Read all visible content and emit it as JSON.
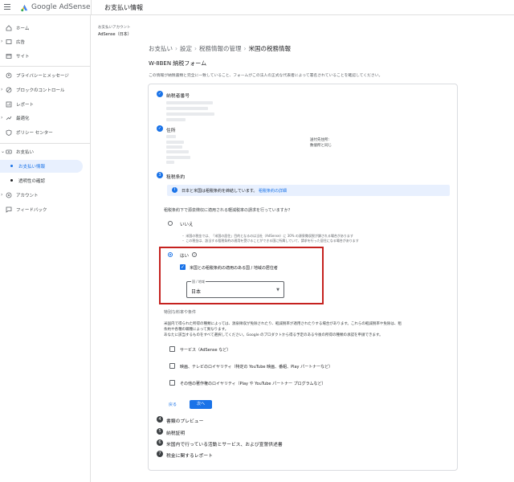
{
  "app": {
    "brand": "Google AdSense",
    "page_heading": "お支払い情報"
  },
  "sidebar": {
    "items": [
      {
        "label": "ホーム",
        "icon": "home-icon"
      },
      {
        "label": "広告",
        "icon": "ads-icon"
      },
      {
        "label": "サイト",
        "icon": "sites-icon"
      },
      {
        "label": "プライバシーとメッセージ",
        "icon": "privacy-icon"
      },
      {
        "label": "ブロックのコントロール",
        "icon": "block-icon"
      },
      {
        "label": "レポート",
        "icon": "report-icon"
      },
      {
        "label": "最適化",
        "icon": "optimize-icon"
      },
      {
        "label": "ポリシー センター",
        "icon": "policy-icon"
      },
      {
        "label": "お支払い",
        "icon": "payments-icon"
      },
      {
        "label": "お支払い情報",
        "icon": "dot-icon"
      },
      {
        "label": "透明性の確認",
        "icon": "dot-icon"
      },
      {
        "label": "アカウント",
        "icon": "account-icon"
      },
      {
        "label": "フィードバック",
        "icon": "feedback-icon"
      }
    ]
  },
  "account": {
    "label": "お支払いアカウント",
    "name": "AdSense（日本）"
  },
  "breadcrumb": [
    "お支払い",
    "設定",
    "税務情報の管理",
    "米国の税務情報"
  ],
  "form": {
    "title": "W-8BEN 納税フォーム",
    "description": "この情報が納税書類と完全に一致していること、フォームがこの法人の正式な代表者によって署名されていることを確認してください。"
  },
  "steps": [
    {
      "label": "納税者番号",
      "state": "done"
    },
    {
      "label": "住所",
      "state": "done"
    },
    {
      "label": "租税条約",
      "state": "current",
      "number": "3"
    },
    {
      "label": "書類のプレビュー",
      "state": "todo",
      "number": "4"
    },
    {
      "label": "納税証明",
      "state": "todo",
      "number": "5"
    },
    {
      "label": "米国内で行っている活動とサービス、および宣誓供述書",
      "state": "todo",
      "number": "6"
    },
    {
      "label": "税金に関するレポート",
      "state": "todo",
      "number": "7"
    }
  ],
  "address_side": {
    "line1": "送付先住所:",
    "line2": "数値所と同じ"
  },
  "treaty": {
    "info_text": "日本と米国は租税条約を締結しています。",
    "info_link": "租税条約の詳細",
    "question": "租税条約下で源泉徴収に適用される軽減税率の請求を行っていますか？",
    "option_no": "いいえ",
    "note_1": "・ 米国の税金では、「米国の居住」目的となるのは当社（AdSense）に 30% の源泉徴収税が課される場合があります",
    "note_2": "・ この税金は、該当する租税条約の適用を受けることができる国に所属していて、請求を行った居住になる場合があります",
    "option_yes": "はい",
    "resident_checkbox": "米国との租税条約の適用のある国 / 地域の居住者",
    "select_float": "国 / 地域",
    "select_value": "日本",
    "special_title": "特別な料率や条件",
    "para_1": "米国内で得られた所得の種類によっては、源泉徴収が免除されたり、軽減税率が適用されたりする場合があります。これらの軽減税率や免除は、租",
    "para_2": "条約や各種の職種によって異なります。",
    "para_3": "あなたに該当するものをすべて選択してください。Google のプロダクトから得る予定のある今後の所得の種類の承認を申請できます。",
    "cb_services": "サービス（AdSense など）",
    "cb_film": "映画、テレビのロイヤリティ（特定の YouTube 映画、番組、Play パートナーなど）",
    "cb_other": "その他の著作権のロイヤリティ（Play や YouTube パートナー プログラムなど）",
    "back_label": "戻る",
    "next_label": "次へ"
  },
  "colors": {
    "accent": "#1a73e8",
    "highlight_border": "#c5221f"
  }
}
